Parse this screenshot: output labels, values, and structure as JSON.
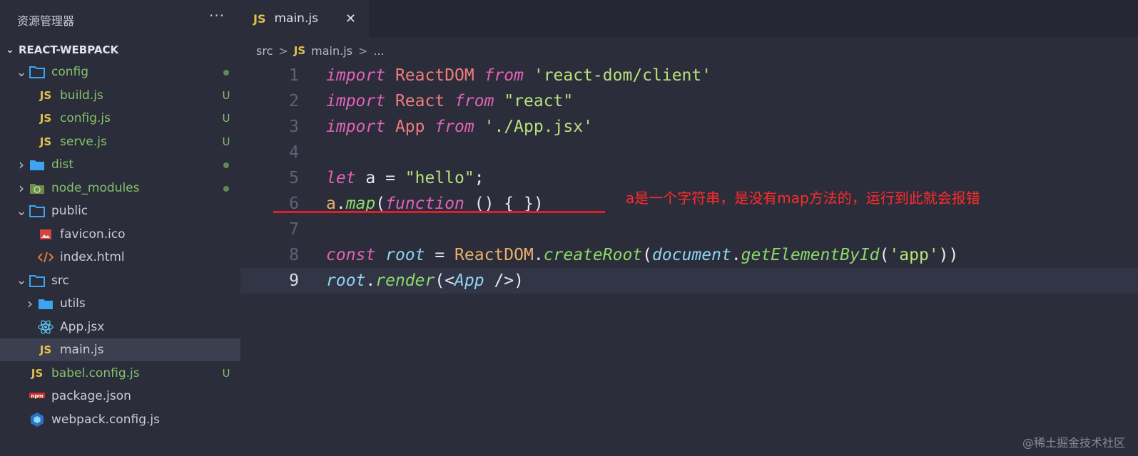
{
  "sidebar": {
    "title": "资源管理器",
    "more": "···",
    "project": "REACT-WEBPACK",
    "items": [
      {
        "label": "config",
        "icon": "folder-open-icon",
        "chev": "v",
        "depth": 0,
        "green": true,
        "status": "dot"
      },
      {
        "label": "build.js",
        "icon": "js-icon",
        "chev": "",
        "depth": 1,
        "green": true,
        "status": "U"
      },
      {
        "label": "config.js",
        "icon": "js-icon",
        "chev": "",
        "depth": 1,
        "green": true,
        "status": "U"
      },
      {
        "label": "serve.js",
        "icon": "js-icon",
        "chev": "",
        "depth": 1,
        "green": true,
        "status": "U"
      },
      {
        "label": "dist",
        "icon": "folder-icon",
        "chev": ">",
        "depth": 0,
        "green": true,
        "status": "dot"
      },
      {
        "label": "node_modules",
        "icon": "node-modules-icon",
        "chev": ">",
        "depth": 0,
        "green": true,
        "status": "dot"
      },
      {
        "label": "public",
        "icon": "folder-open-icon",
        "chev": "v",
        "depth": 0,
        "green": false,
        "status": ""
      },
      {
        "label": "favicon.ico",
        "icon": "image-icon",
        "chev": "",
        "depth": 1,
        "green": false,
        "status": ""
      },
      {
        "label": "index.html",
        "icon": "html-icon",
        "chev": "",
        "depth": 1,
        "green": false,
        "status": ""
      },
      {
        "label": "src",
        "icon": "folder-open-icon",
        "chev": "v",
        "depth": 0,
        "green": false,
        "status": ""
      },
      {
        "label": "utils",
        "icon": "folder-icon",
        "chev": ">",
        "depth": 1,
        "green": false,
        "status": ""
      },
      {
        "label": "App.jsx",
        "icon": "react-icon",
        "chev": "",
        "depth": 1,
        "green": false,
        "status": ""
      },
      {
        "label": "main.js",
        "icon": "js-icon",
        "chev": "",
        "depth": 1,
        "green": false,
        "status": "",
        "selected": true
      },
      {
        "label": "babel.config.js",
        "icon": "js-icon",
        "chev": "",
        "depth": 0,
        "green": true,
        "status": "U"
      },
      {
        "label": "package.json",
        "icon": "npm-icon",
        "chev": "",
        "depth": 0,
        "green": false,
        "status": ""
      },
      {
        "label": "webpack.config.js",
        "icon": "webpack-icon",
        "chev": "",
        "depth": 0,
        "green": false,
        "status": ""
      }
    ]
  },
  "tab": {
    "badge": "JS",
    "label": "main.js",
    "close": "✕"
  },
  "breadcrumb": {
    "folder": "src",
    "sep": ">",
    "badge": "JS",
    "file": "main.js",
    "sep2": ">",
    "more": "..."
  },
  "code": {
    "current_line": 9,
    "lines": [
      {
        "n": "1",
        "tokens": [
          [
            "kw",
            "import"
          ],
          [
            "plain",
            " "
          ],
          [
            "cls",
            "ReactDOM"
          ],
          [
            "plain",
            " "
          ],
          [
            "kw",
            "from"
          ],
          [
            "plain",
            " "
          ],
          [
            "str",
            "'react-dom/client'"
          ]
        ]
      },
      {
        "n": "2",
        "tokens": [
          [
            "kw",
            "import"
          ],
          [
            "plain",
            " "
          ],
          [
            "cls",
            "React"
          ],
          [
            "plain",
            " "
          ],
          [
            "kw",
            "from"
          ],
          [
            "plain",
            " "
          ],
          [
            "str",
            "\"react\""
          ]
        ]
      },
      {
        "n": "3",
        "tokens": [
          [
            "kw",
            "import"
          ],
          [
            "plain",
            " "
          ],
          [
            "cls",
            "App"
          ],
          [
            "plain",
            " "
          ],
          [
            "kw",
            "from"
          ],
          [
            "plain",
            " "
          ],
          [
            "str",
            "'./App.jsx'"
          ]
        ]
      },
      {
        "n": "4",
        "tokens": []
      },
      {
        "n": "5",
        "tokens": [
          [
            "kw",
            "let"
          ],
          [
            "plain",
            " a = "
          ],
          [
            "str",
            "\"hello\""
          ],
          [
            "plain",
            ";"
          ]
        ]
      },
      {
        "n": "6",
        "tokens": [
          [
            "prop",
            "a"
          ],
          [
            "punc",
            "."
          ],
          [
            "fn",
            "map"
          ],
          [
            "punc",
            "("
          ],
          [
            "kw",
            "function"
          ],
          [
            "punc",
            " () { })"
          ]
        ]
      },
      {
        "n": "7",
        "tokens": []
      },
      {
        "n": "8",
        "tokens": [
          [
            "kw",
            "const"
          ],
          [
            "plain",
            " "
          ],
          [
            "var",
            "root"
          ],
          [
            "plain",
            " = "
          ],
          [
            "prop",
            "ReactDOM"
          ],
          [
            "punc",
            "."
          ],
          [
            "fn",
            "createRoot"
          ],
          [
            "punc",
            "("
          ],
          [
            "var",
            "document"
          ],
          [
            "punc",
            "."
          ],
          [
            "fn",
            "getElementById"
          ],
          [
            "punc",
            "("
          ],
          [
            "str",
            "'app'"
          ],
          [
            "punc",
            "))"
          ]
        ]
      },
      {
        "n": "9",
        "tokens": [
          [
            "var",
            "root"
          ],
          [
            "punc",
            "."
          ],
          [
            "fn",
            "render"
          ],
          [
            "punc",
            "(<"
          ],
          [
            "var",
            "App"
          ],
          [
            "punc",
            " />)"
          ]
        ]
      }
    ]
  },
  "annotation": "a是一个字符串，是没有map方法的，运行到此就会报错",
  "watermark": "@稀土掘金技术社区",
  "colors": {
    "accent_red": "#e01e2a",
    "js_yellow": "#e3c14f",
    "git_green": "#83c26b"
  }
}
